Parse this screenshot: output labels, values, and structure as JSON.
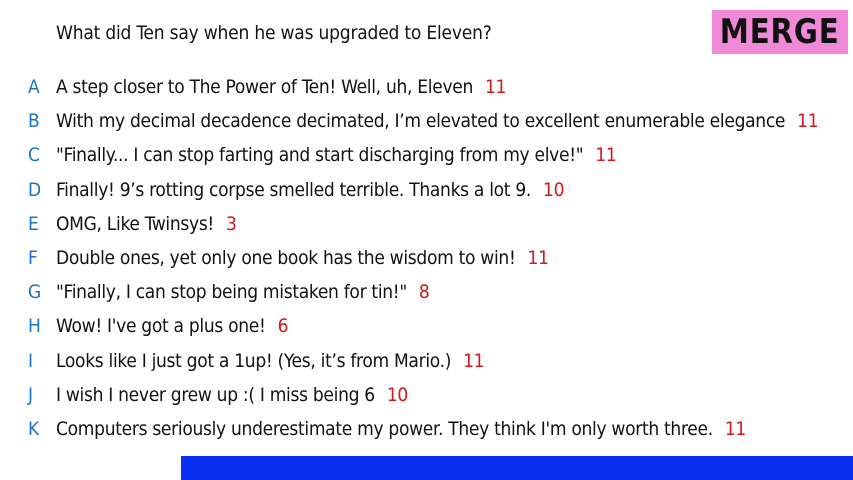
{
  "question": "What did Ten say when he was upgraded to Eleven?",
  "badge": "MERGE",
  "answers": [
    {
      "letter": "A",
      "text": "A step closer to The Power of Ten! Well, uh, Eleven",
      "score": "11"
    },
    {
      "letter": "B",
      "text": "With my decimal decadence decimated, I’m elevated to excellent enumerable elegance",
      "score": "11"
    },
    {
      "letter": "C",
      "text": "\"Finally... I can stop farting and start discharging from my elve!\"",
      "score": "11"
    },
    {
      "letter": "D",
      "text": "Finally! 9’s rotting corpse smelled terrible. Thanks a lot 9.",
      "score": "10"
    },
    {
      "letter": "E",
      "text": "OMG, Like Twinsys!",
      "score": "3"
    },
    {
      "letter": "F",
      "text": "Double ones, yet only one book has the wisdom to win!",
      "score": "11"
    },
    {
      "letter": "G",
      "text": "\"Finally, I can stop being mistaken for tin!\"",
      "score": "8"
    },
    {
      "letter": "H",
      "text": "Wow! I've got a plus one!",
      "score": "6"
    },
    {
      "letter": "I",
      "text": "Looks like I just got a 1up! (Yes, it’s from Mario.)",
      "score": "11"
    },
    {
      "letter": "J",
      "text": "I wish I never grew up :( I miss being 6",
      "score": "10"
    },
    {
      "letter": "K",
      "text": "Computers seriously underestimate my power. They think I'm only worth three.",
      "score": "11"
    }
  ],
  "colors": {
    "letter": "#1b74c8",
    "score": "#d0181b",
    "badge_bg": "#f08ad8",
    "bottom_bar": "#0a2ff0"
  }
}
